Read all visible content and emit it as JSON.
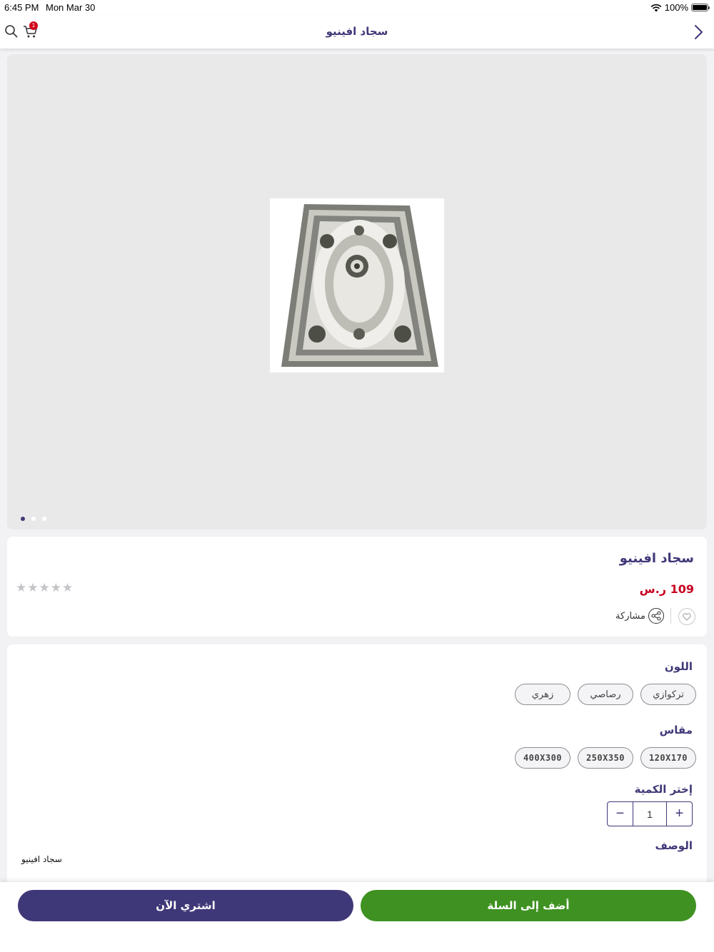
{
  "status_bar": {
    "time": "6:45 PM",
    "date": "Mon Mar 30",
    "battery": "100%",
    "battery_level": 1.0
  },
  "nav": {
    "title": "سجاد افينيو",
    "cart_count": "1"
  },
  "gallery": {
    "image_count": 3,
    "active_index": 0
  },
  "product": {
    "title": "سجاد افينيو",
    "price": "109 ر.س",
    "rating": 0,
    "share_label": "مشاركة"
  },
  "options": {
    "color_label": "اللون",
    "colors": [
      "تركوازي",
      "رصاصي",
      "زهري"
    ],
    "size_label": "مقاس",
    "sizes": [
      "120X170",
      "250X350",
      "400X300"
    ],
    "quantity_label": "إختر الكمية",
    "quantity": "1",
    "plus": "+",
    "minus": "−",
    "description_label": "الوصف",
    "description": "سجاد افينيو"
  },
  "actions": {
    "add_to_cart": "أضف إلى السلة",
    "buy_now": "اشتري الآن"
  },
  "colors": {
    "brand": "#3f3878",
    "price": "#c70021",
    "cart_button": "#3f9222",
    "badge": "#d0021b"
  }
}
